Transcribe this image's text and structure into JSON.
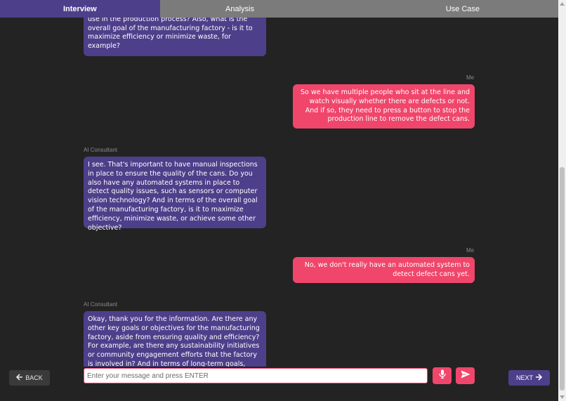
{
  "tabs": [
    {
      "label": "Interview",
      "active": true
    },
    {
      "label": "Analysis",
      "active": false
    },
    {
      "label": "Use Case",
      "active": false
    }
  ],
  "messages": [
    {
      "sender": "",
      "role": "ai",
      "text": "any particular techniques or technologies that you use in the production process? Also, what is the overall goal of the manufacturing factory - is it to maximize efficiency or minimize waste, for example?"
    },
    {
      "sender": "Me",
      "role": "me",
      "text": "So we have multiple people who sit at the line and watch visually whether there are defects or not. And if so, they need to press a button to stop the production line to remove the defect cans."
    },
    {
      "sender": "AI Consultant",
      "role": "ai",
      "text": "I see. That's important to have manual inspections in place to ensure the quality of the cans. Do you also have any automated systems in place to detect quality issues, such as sensors or computer vision technology? And in terms of the overall goal of the manufacturing factory, is it to maximize efficiency, minimize waste, or achieve some other objective?"
    },
    {
      "sender": "Me",
      "role": "me",
      "text": "No, we don't really have an automated system to detect defect cans yet."
    },
    {
      "sender": "AI Consultant",
      "role": "ai",
      "text": "Okay, thank you for the information. Are there any other key goals or objectives for the manufacturing factory, aside from ensuring quality and efficiency? For example, are there any sustainability initiatives or community engagement efforts that the factory is involved in? And in terms of long-term goals, what are some of the key"
    }
  ],
  "input": {
    "placeholder": "Enter your message and press ENTER",
    "value": ""
  },
  "buttons": {
    "back": "BACK",
    "next": "NEXT"
  },
  "icons": {
    "back": "arrow-left-icon",
    "next": "arrow-right-icon",
    "mic": "microphone-icon",
    "send": "send-icon"
  },
  "colors": {
    "accent_purple": "#4e3f8a",
    "accent_pink": "#f0466b",
    "background": "#232323",
    "tab_bar": "#7b7b7b"
  }
}
